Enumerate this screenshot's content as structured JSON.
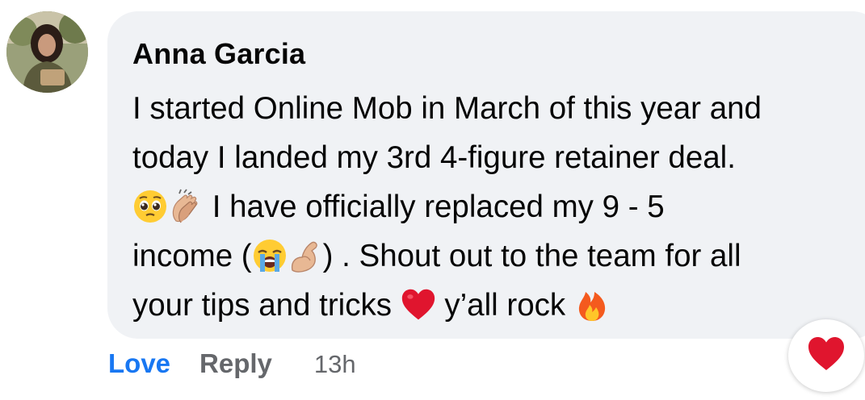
{
  "comment": {
    "author": "Anna Garcia",
    "lines": [
      {
        "segments": [
          {
            "t": "I started Online Mob in March of this year and"
          }
        ]
      },
      {
        "segments": [
          {
            "t": "today I landed my 3rd 4-figure retainer deal."
          }
        ]
      },
      {
        "segments": [
          {
            "emoji": "pleading-face"
          },
          {
            "emoji": "clapping-hands"
          },
          {
            "t": " I have officially replaced my 9 - 5"
          }
        ]
      },
      {
        "segments": [
          {
            "t": "income ("
          },
          {
            "emoji": "crying-face"
          },
          {
            "emoji": "flexed-biceps"
          },
          {
            "t": ") . Shout out to the team for all"
          }
        ]
      },
      {
        "segments": [
          {
            "t": "your tips and tricks "
          },
          {
            "emoji": "red-heart"
          },
          {
            "t": " y’all rock "
          },
          {
            "emoji": "fire"
          }
        ]
      }
    ]
  },
  "actions": {
    "love_label": "Love",
    "reply_label": "Reply",
    "timestamp": "13h"
  },
  "reaction": {
    "icon": "red-heart",
    "color": "#e0152e"
  },
  "colors": {
    "bubble": "#f0f2f5",
    "link_blue": "#1877f2",
    "muted": "#65676b",
    "text": "#050505"
  }
}
